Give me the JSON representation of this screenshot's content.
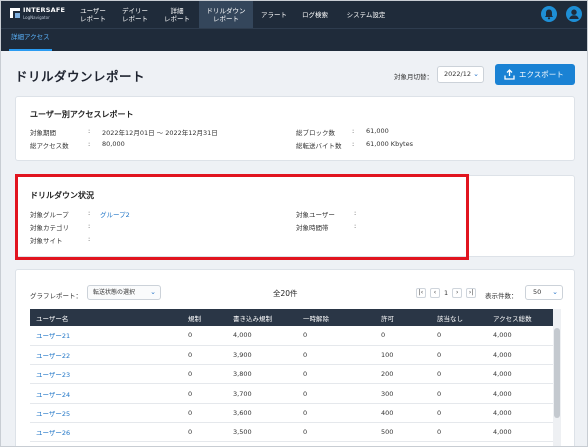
{
  "brand": {
    "name": "INTERSAFE",
    "sub": "LogNavigator"
  },
  "nav": [
    {
      "label": "ユーザー\nレポート",
      "active": false
    },
    {
      "label": "デイリー\nレポート",
      "active": false
    },
    {
      "label": "詳細\nレポート",
      "active": false
    },
    {
      "label": "ドリルダウン\nレポート",
      "active": true
    },
    {
      "label": "アラート",
      "active": false
    },
    {
      "label": "ログ検索",
      "active": false
    },
    {
      "label": "システム設定",
      "active": false
    }
  ],
  "subnav": {
    "tab": "詳細アクセス"
  },
  "header": {
    "title": "ドリルダウンレポート",
    "month_label": "対象月切替：",
    "month_value": "2022/12",
    "export_label": "エクスポート"
  },
  "user_report": {
    "title": "ユーザー別アクセスレポート",
    "period_label": "対象期間",
    "period_value": "2022年12月01日 〜 2022年12月31日",
    "total_access_label": "総アクセス数",
    "total_access_value": "80,000",
    "total_block_label": "総ブロック数",
    "total_block_value": "61,000",
    "total_bytes_label": "総転送バイト数",
    "total_bytes_value": "61,000 Kbytes"
  },
  "drilldown": {
    "title": "ドリルダウン状況",
    "group_label": "対象グループ",
    "group_value": "グループ2",
    "category_label": "対象カテゴリ",
    "category_value": "",
    "site_label": "対象サイト",
    "site_value": "",
    "user_label": "対象ユーザー",
    "user_value": "",
    "time_label": "対象時間帯",
    "time_value": ""
  },
  "report": {
    "graph_label": "グラフレポート：",
    "graph_select": "転送状態の選択",
    "total": "全20件",
    "page": "1",
    "perpage_label": "表示件数：",
    "perpage_value": "50",
    "columns": [
      "ユーザー名",
      "規制",
      "書き込み規制",
      "一時解除",
      "許可",
      "該当なし",
      "アクセス総数"
    ],
    "rows": [
      [
        "ユーザー21",
        "0",
        "4,000",
        "0",
        "0",
        "0",
        "4,000"
      ],
      [
        "ユーザー22",
        "0",
        "3,900",
        "0",
        "100",
        "0",
        "4,000"
      ],
      [
        "ユーザー23",
        "0",
        "3,800",
        "0",
        "200",
        "0",
        "4,000"
      ],
      [
        "ユーザー24",
        "0",
        "3,700",
        "0",
        "300",
        "0",
        "4,000"
      ],
      [
        "ユーザー25",
        "0",
        "3,600",
        "0",
        "400",
        "0",
        "4,000"
      ],
      [
        "ユーザー26",
        "0",
        "3,500",
        "0",
        "500",
        "0",
        "4,000"
      ]
    ]
  },
  "colors": {
    "nav_bg": "#1f2b3a",
    "accent": "#1a82d4",
    "link": "#2176c7",
    "highlight": "#e1141f"
  }
}
